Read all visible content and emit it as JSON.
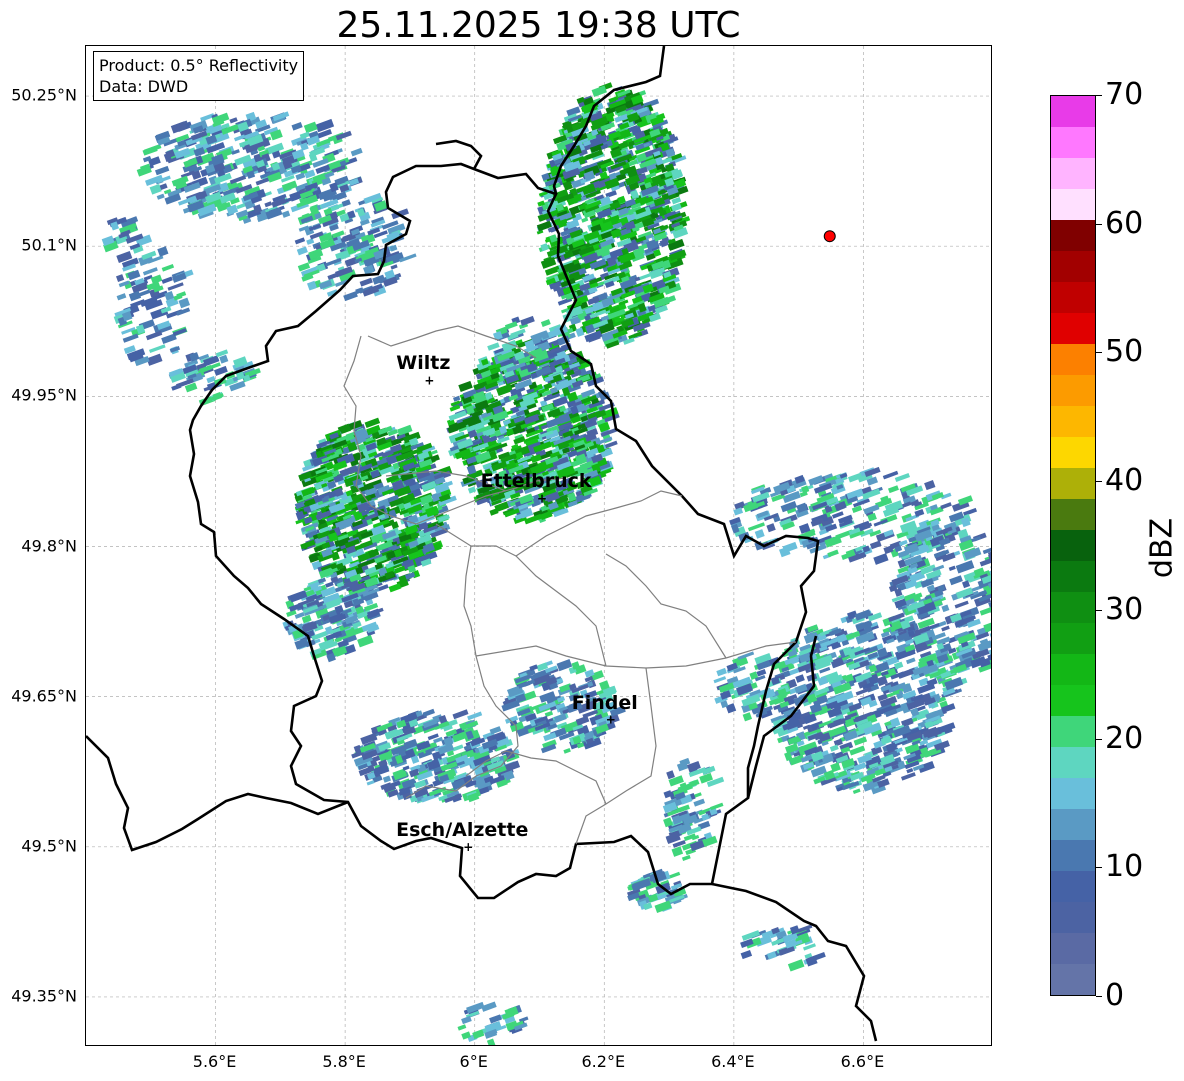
{
  "title": "25.11.2025 19:38 UTC",
  "info": {
    "product": "Product: 0.5° Reflectivity",
    "data": "Data: DWD"
  },
  "lat_ticks": [
    "50.25°N",
    "50.1°N",
    "49.95°N",
    "49.8°N",
    "49.65°N",
    "49.5°N",
    "49.35°N"
  ],
  "lon_ticks": [
    "5.6°E",
    "5.8°E",
    "6°E",
    "6.2°E",
    "6.4°E",
    "6.6°E"
  ],
  "cities": [
    {
      "name": "Wiltz",
      "lon": 5.93,
      "lat": 49.966
    },
    {
      "name": "Ettelbruck",
      "lon": 6.104,
      "lat": 49.848
    },
    {
      "name": "Findel",
      "lon": 6.21,
      "lat": 49.627
    },
    {
      "name": "Esch/Alzette",
      "lon": 5.99,
      "lat": 49.5
    }
  ],
  "radar_site": {
    "lon": 6.548,
    "lat": 50.11,
    "color": "#ff0000"
  },
  "extent": {
    "lon": [
      5.4,
      6.8
    ],
    "lat": [
      49.3,
      50.3
    ]
  },
  "colorbar": {
    "unit": "dBZ",
    "min": 0,
    "max": 70,
    "tick_labels": [
      "0",
      "10",
      "20",
      "30",
      "40",
      "50",
      "60",
      "70"
    ],
    "colors": [
      "#6474a8",
      "#5a6aa4",
      "#4c63a3",
      "#4562a6",
      "#4a78b0",
      "#5a9ac4",
      "#69bfdb",
      "#5ed6c0",
      "#3fd67a",
      "#16c41c",
      "#13b716",
      "#119f13",
      "#0f8f12",
      "#0b7a10",
      "#08620d",
      "#4a7a0f",
      "#adb008",
      "#fdd700",
      "#fdb700",
      "#fc9b00",
      "#fc8000",
      "#e00000",
      "#c00000",
      "#a20000",
      "#800000",
      "#ffe0ff",
      "#ffb4ff",
      "#ff78ff",
      "#e83be8"
    ]
  },
  "colors": {
    "border_country": "#000000",
    "border_canton": "#888888",
    "grid": "#b0b0b0"
  }
}
